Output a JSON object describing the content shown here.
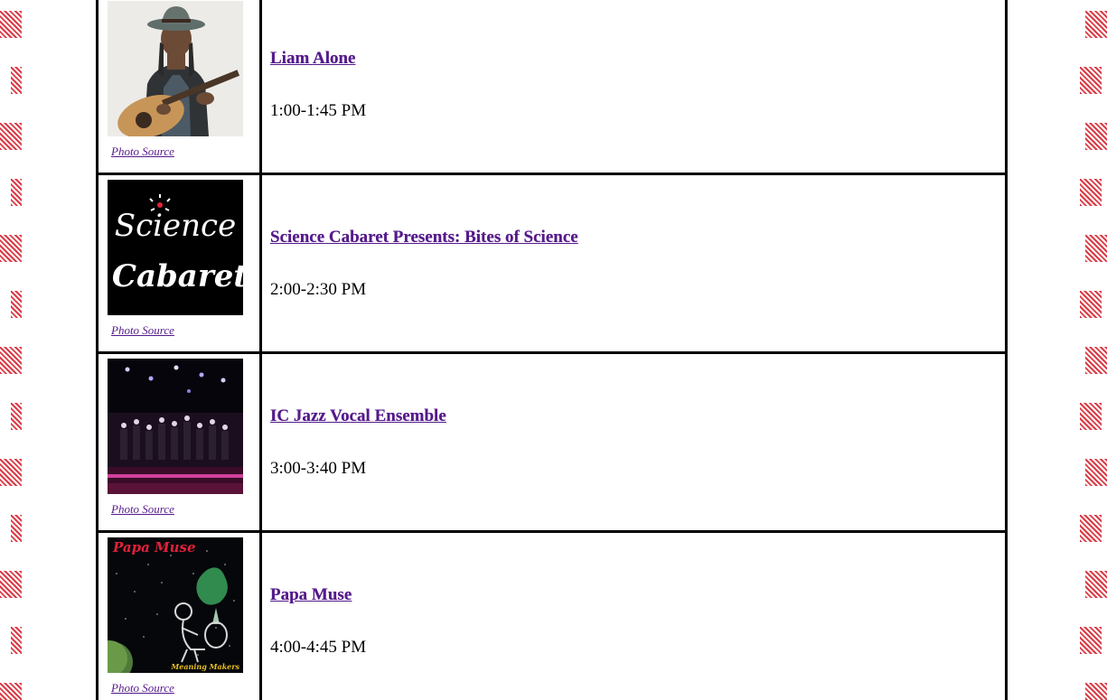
{
  "schedule": [
    {
      "title": "",
      "time": "",
      "photo_label": "Photo Source",
      "image": "performer-photo"
    },
    {
      "title": "Liam Alone",
      "time": "1:00-1:45 PM",
      "photo_label": "Photo Source",
      "image": "guitarist-photo"
    },
    {
      "title": "Science Cabaret Presents: Bites of Science",
      "time": "2:00-2:30 PM",
      "photo_label": "Photo Source",
      "image": "science-cabaret-logo",
      "logo_text": [
        "Science",
        "Cabaret"
      ]
    },
    {
      "title": "IC Jazz Vocal Ensemble",
      "time": "3:00-3:40 PM",
      "photo_label": "Photo Source",
      "image": "stage-concert-photo"
    },
    {
      "title": "Papa Muse",
      "time": "4:00-4:45 PM",
      "photo_label": "Photo Source",
      "image": "papa-muse-album-art",
      "logo_text": [
        "Papa Muse",
        "Meaning Makers"
      ]
    }
  ],
  "colors": {
    "link": "#551a8b",
    "border": "#000000",
    "stripe": "#d93b45"
  }
}
